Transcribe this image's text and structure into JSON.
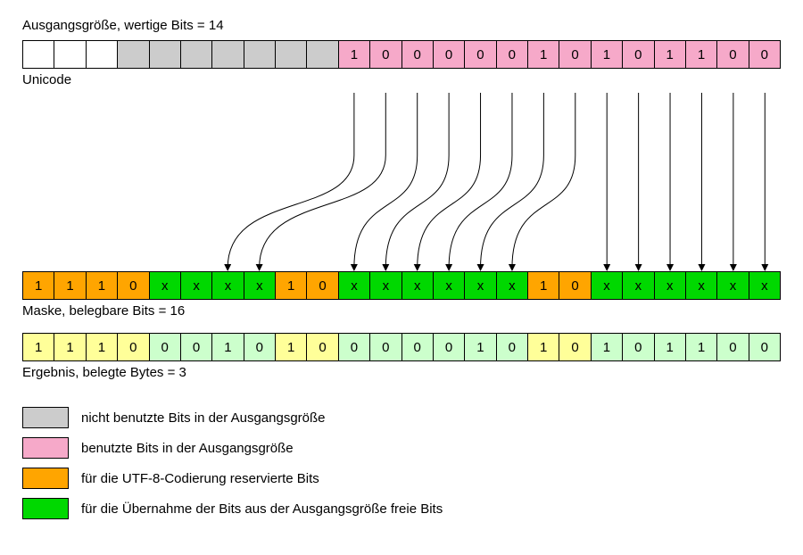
{
  "chart_data": {
    "type": "table",
    "title": "Ausgangsgröße, wertige Bits = 14",
    "rows": {
      "unicode": {
        "label": "Unicode",
        "cells": [
          {
            "v": "",
            "c": "c-empty"
          },
          {
            "v": "",
            "c": "c-empty"
          },
          {
            "v": "",
            "c": "c-empty"
          },
          {
            "v": "",
            "c": "c-gray"
          },
          {
            "v": "",
            "c": "c-gray"
          },
          {
            "v": "",
            "c": "c-gray"
          },
          {
            "v": "",
            "c": "c-gray"
          },
          {
            "v": "",
            "c": "c-gray"
          },
          {
            "v": "",
            "c": "c-gray"
          },
          {
            "v": "",
            "c": "c-gray"
          },
          {
            "v": "1",
            "c": "c-pink"
          },
          {
            "v": "0",
            "c": "c-pink"
          },
          {
            "v": "0",
            "c": "c-pink"
          },
          {
            "v": "0",
            "c": "c-pink"
          },
          {
            "v": "0",
            "c": "c-pink"
          },
          {
            "v": "0",
            "c": "c-pink"
          },
          {
            "v": "1",
            "c": "c-pink"
          },
          {
            "v": "0",
            "c": "c-pink"
          },
          {
            "v": "1",
            "c": "c-pink"
          },
          {
            "v": "0",
            "c": "c-pink"
          },
          {
            "v": "1",
            "c": "c-pink"
          },
          {
            "v": "1",
            "c": "c-pink"
          },
          {
            "v": "0",
            "c": "c-pink"
          },
          {
            "v": "0",
            "c": "c-pink"
          }
        ]
      },
      "mask": {
        "label": "Maske, belegbare Bits = 16",
        "cells": [
          {
            "v": "1",
            "c": "c-orange"
          },
          {
            "v": "1",
            "c": "c-orange"
          },
          {
            "v": "1",
            "c": "c-orange"
          },
          {
            "v": "0",
            "c": "c-orange"
          },
          {
            "v": "x",
            "c": "c-green"
          },
          {
            "v": "x",
            "c": "c-green"
          },
          {
            "v": "x",
            "c": "c-green"
          },
          {
            "v": "x",
            "c": "c-green"
          },
          {
            "v": "1",
            "c": "c-orange"
          },
          {
            "v": "0",
            "c": "c-orange"
          },
          {
            "v": "x",
            "c": "c-green"
          },
          {
            "v": "x",
            "c": "c-green"
          },
          {
            "v": "x",
            "c": "c-green"
          },
          {
            "v": "x",
            "c": "c-green"
          },
          {
            "v": "x",
            "c": "c-green"
          },
          {
            "v": "x",
            "c": "c-green"
          },
          {
            "v": "1",
            "c": "c-orange"
          },
          {
            "v": "0",
            "c": "c-orange"
          },
          {
            "v": "x",
            "c": "c-green"
          },
          {
            "v": "x",
            "c": "c-green"
          },
          {
            "v": "x",
            "c": "c-green"
          },
          {
            "v": "x",
            "c": "c-green"
          },
          {
            "v": "x",
            "c": "c-green"
          },
          {
            "v": "x",
            "c": "c-green"
          }
        ]
      },
      "result": {
        "label": "Ergebnis, belegte Bytes = 3",
        "cells": [
          {
            "v": "1",
            "c": "c-yellow"
          },
          {
            "v": "1",
            "c": "c-yellow"
          },
          {
            "v": "1",
            "c": "c-yellow"
          },
          {
            "v": "0",
            "c": "c-yellow"
          },
          {
            "v": "0",
            "c": "c-lgreen"
          },
          {
            "v": "0",
            "c": "c-lgreen"
          },
          {
            "v": "1",
            "c": "c-lgreen"
          },
          {
            "v": "0",
            "c": "c-lgreen"
          },
          {
            "v": "1",
            "c": "c-yellow"
          },
          {
            "v": "0",
            "c": "c-yellow"
          },
          {
            "v": "0",
            "c": "c-lgreen"
          },
          {
            "v": "0",
            "c": "c-lgreen"
          },
          {
            "v": "0",
            "c": "c-lgreen"
          },
          {
            "v": "0",
            "c": "c-lgreen"
          },
          {
            "v": "1",
            "c": "c-lgreen"
          },
          {
            "v": "0",
            "c": "c-lgreen"
          },
          {
            "v": "1",
            "c": "c-yellow"
          },
          {
            "v": "0",
            "c": "c-yellow"
          },
          {
            "v": "1",
            "c": "c-lgreen"
          },
          {
            "v": "0",
            "c": "c-lgreen"
          },
          {
            "v": "1",
            "c": "c-lgreen"
          },
          {
            "v": "1",
            "c": "c-lgreen"
          },
          {
            "v": "0",
            "c": "c-lgreen"
          },
          {
            "v": "0",
            "c": "c-lgreen"
          }
        ]
      }
    },
    "arrows": [
      {
        "from": 10,
        "to": 6
      },
      {
        "from": 11,
        "to": 7
      },
      {
        "from": 12,
        "to": 10
      },
      {
        "from": 13,
        "to": 11
      },
      {
        "from": 14,
        "to": 12
      },
      {
        "from": 15,
        "to": 13
      },
      {
        "from": 16,
        "to": 14
      },
      {
        "from": 17,
        "to": 15
      },
      {
        "from": 18,
        "to": 18
      },
      {
        "from": 19,
        "to": 19
      },
      {
        "from": 20,
        "to": 20
      },
      {
        "from": 21,
        "to": 21
      },
      {
        "from": 22,
        "to": 22
      },
      {
        "from": 23,
        "to": 23
      }
    ],
    "legend": [
      {
        "c": "c-gray",
        "label": "nicht benutzte Bits in der Ausgangsgröße"
      },
      {
        "c": "c-pink",
        "label": "benutzte Bits in der Ausgangsgröße"
      },
      {
        "c": "c-orange",
        "label": "für die UTF-8-Codierung reservierte Bits"
      },
      {
        "c": "c-green",
        "label": "für die Übernahme der Bits aus der Ausgangsgröße freie Bits"
      }
    ]
  }
}
